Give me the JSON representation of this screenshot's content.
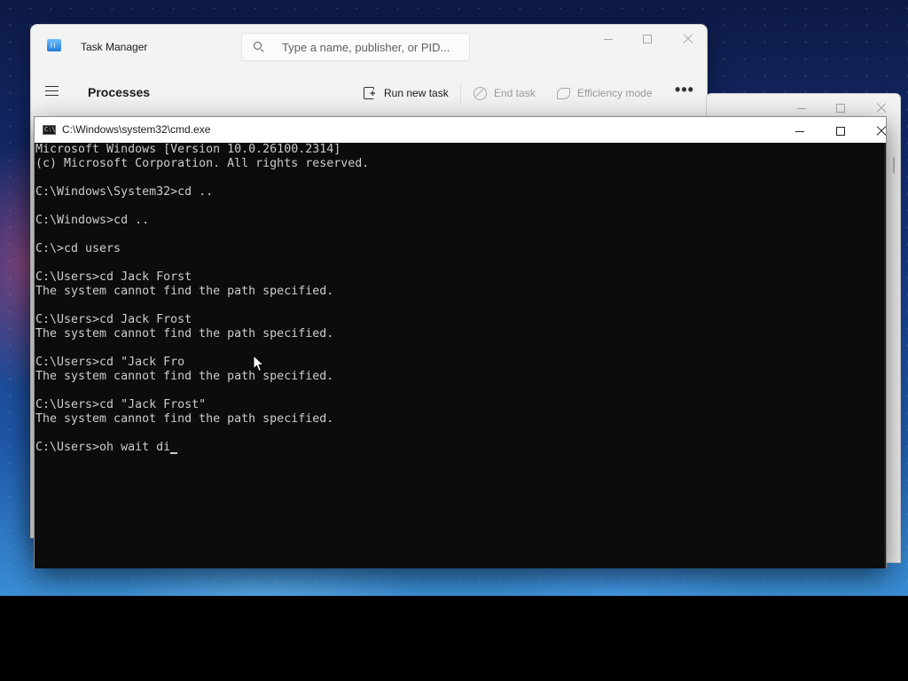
{
  "taskmgr": {
    "title": "Task Manager",
    "search_placeholder": "Type a name, publisher, or PID...",
    "nav_title": "Processes",
    "commands": {
      "run_new_task": "Run new task",
      "end_task": "End task",
      "efficiency_mode": "Efficiency mode",
      "more": "•••"
    }
  },
  "cmd": {
    "title": "C:\\Windows\\system32\\cmd.exe",
    "lines": [
      "Microsoft Windows [Version 10.0.26100.2314]",
      "(c) Microsoft Corporation. All rights reserved.",
      "",
      "C:\\Windows\\System32>cd ..",
      "",
      "C:\\Windows>cd ..",
      "",
      "C:\\>cd users",
      "",
      "C:\\Users>cd Jack Forst",
      "The system cannot find the path specified.",
      "",
      "C:\\Users>cd Jack Frost",
      "The system cannot find the path specified.",
      "",
      "C:\\Users>cd \"Jack Fro",
      "The system cannot find the path specified.",
      "",
      "C:\\Users>cd \"Jack Frost\"",
      "The system cannot find the path specified.",
      "",
      "C:\\Users>oh wait di"
    ]
  },
  "icons": {
    "taskmgr_app": "task-manager-icon",
    "search": "search-icon",
    "menu": "hamburger-icon",
    "run": "run-task-icon",
    "end": "end-task-icon",
    "efficiency": "leaf-icon",
    "cmd_app": "cmd-icon",
    "cursor": "mouse-pointer-icon"
  }
}
